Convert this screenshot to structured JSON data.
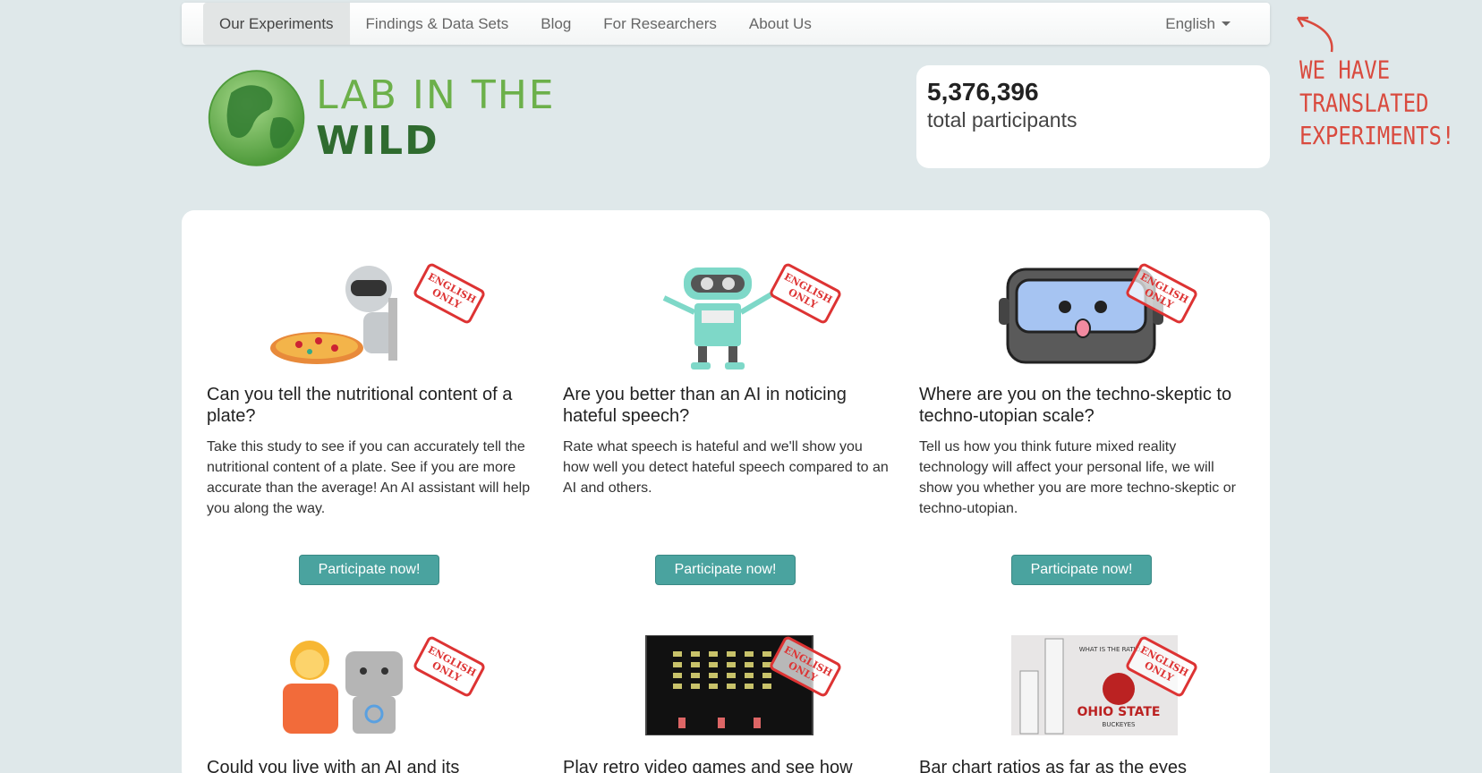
{
  "nav": {
    "items": [
      "Our Experiments",
      "Findings & Data Sets",
      "Blog",
      "For Researchers",
      "About Us"
    ],
    "language": "English"
  },
  "logo": {
    "part1": "LAB IN THE ",
    "part2": "WILD"
  },
  "stats": {
    "count": "5,376,396",
    "label": "total participants"
  },
  "note": {
    "text": "WE HAVE TRANSLATED EXPERIMENTS!"
  },
  "stamp": "ENGLISH ONLY",
  "experiments": [
    {
      "title": "Can you tell the nutritional content of a plate?",
      "description": "Take this study to see if you can accurately tell the nutritional content of a plate. See if you are more accurate than the average! An AI assistant will help you along the way.",
      "button": "Participate now!",
      "icon": "robot-pizza-icon"
    },
    {
      "title": "Are you better than an AI in noticing hateful speech?",
      "description": "Rate what speech is hateful and we'll show you how well you detect hateful speech compared to an AI and others.",
      "button": "Participate now!",
      "icon": "teal-robot-icon"
    },
    {
      "title": "Where are you on the techno-skeptic to techno-utopian scale?",
      "description": "Tell us how you think future mixed reality technology will affect your personal life, we will show you whether you are more techno-skeptic or techno-utopian.",
      "button": "Participate now!",
      "icon": "vr-headset-icon"
    },
    {
      "title": "Could you live with an AI and its",
      "icon": "person-robot-icon"
    },
    {
      "title": "Play retro video games and see how",
      "icon": "space-invaders-icon",
      "screen_text": ""
    },
    {
      "title": "Bar chart ratios as far as the eyes",
      "icon": "bar-chart-ratio-icon",
      "chart_caption": "WHAT IS THE RATIO",
      "logo_text": "OHIO STATE",
      "logo_subtext": "BUCKEYES"
    }
  ],
  "colors": {
    "button": "#4aa39f",
    "note": "#d94a3e",
    "stamp": "#dd3333"
  }
}
